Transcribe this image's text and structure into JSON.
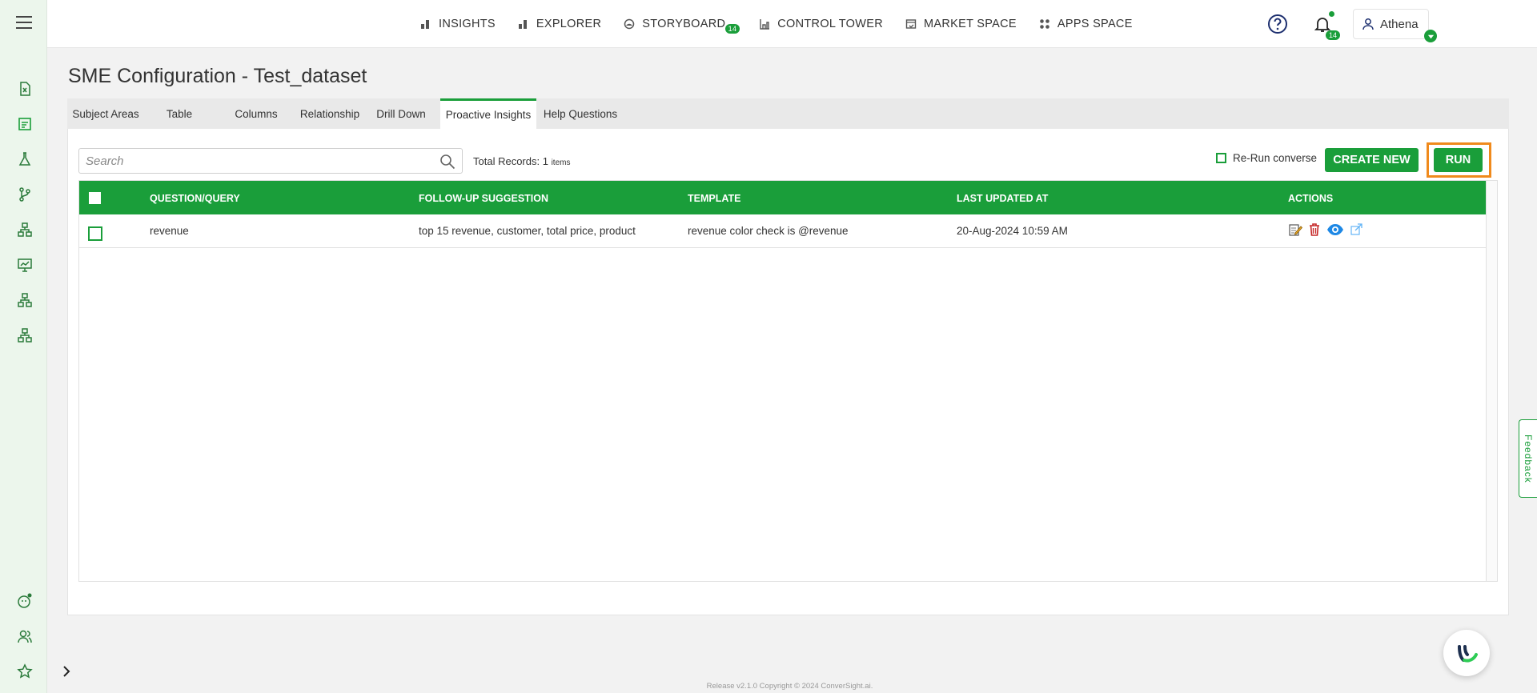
{
  "nav": {
    "items": [
      {
        "label": "INSIGHTS",
        "icon": "bar-chart-icon"
      },
      {
        "label": "EXPLORER",
        "icon": "bar-chart-icon"
      },
      {
        "label": "STORYBOARD",
        "icon": "storyboard-icon",
        "badge": "14"
      },
      {
        "label": "CONTROL TOWER",
        "icon": "tower-icon"
      },
      {
        "label": "MARKET SPACE",
        "icon": "market-icon"
      },
      {
        "label": "APPS SPACE",
        "icon": "apps-grid-icon"
      }
    ]
  },
  "header": {
    "notification_count": "14",
    "user_name": "Athena"
  },
  "page": {
    "title": "SME Configuration - Test_dataset"
  },
  "tabs": [
    {
      "label": "Subject Areas"
    },
    {
      "label": "Table"
    },
    {
      "label": "Columns"
    },
    {
      "label": "Relationship"
    },
    {
      "label": "Drill Down"
    },
    {
      "label": "Proactive Insights",
      "active": true
    },
    {
      "label": "Help Questions"
    }
  ],
  "toolbar": {
    "search_placeholder": "Search",
    "total_label": "Total Records:",
    "total_count": "1",
    "total_unit": "items",
    "rerun_label": "Re-Run converse",
    "create_label": "CREATE NEW",
    "run_label": "RUN"
  },
  "table": {
    "columns": [
      "QUESTION/QUERY",
      "FOLLOW-UP SUGGESTION",
      "TEMPLATE",
      "LAST UPDATED AT",
      "ACTIONS"
    ],
    "rows": [
      {
        "question": "revenue",
        "followup": "top 15 revenue, customer, total price, product",
        "template": "revenue color check is @revenue",
        "updated": "20-Aug-2024 10:59 AM"
      }
    ]
  },
  "feedback_label": "Feedback",
  "footer": "Release v2.1.0 Copyright © 2024 ConverSight.ai.",
  "colors": {
    "accent": "#1a9e3a",
    "highlight": "#f08a1c",
    "sidebar_bg": "#ecf6ec"
  }
}
